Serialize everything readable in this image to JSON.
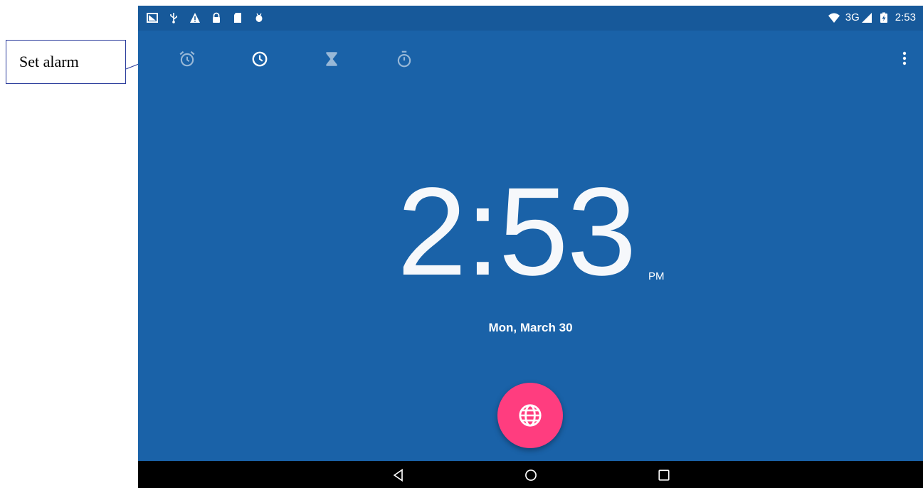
{
  "annotation": {
    "label": "Set alarm"
  },
  "statusbar": {
    "left_icons": [
      "screenshot-icon",
      "usb-icon",
      "warning-icon",
      "lock-icon",
      "sd-card-icon",
      "android-debug-icon"
    ],
    "network": "3G",
    "time": "2:53"
  },
  "tabs": [
    {
      "name": "alarm",
      "icon": "alarm-icon",
      "selected": false
    },
    {
      "name": "clock",
      "icon": "clock-icon",
      "selected": true
    },
    {
      "name": "timer",
      "icon": "hourglass-icon",
      "selected": false
    },
    {
      "name": "stopwatch",
      "icon": "stopwatch-icon",
      "selected": false
    }
  ],
  "clock": {
    "time": "2:53",
    "ampm": "PM",
    "date": "Mon, March 30"
  },
  "fab": {
    "icon": "globe-icon"
  },
  "colors": {
    "background": "#1a62a8",
    "statusbar": "#17599a",
    "fab": "#ff3d7f",
    "callout_border": "#2b3c9c"
  },
  "navbar": {
    "buttons": [
      "back",
      "home",
      "recents"
    ]
  }
}
